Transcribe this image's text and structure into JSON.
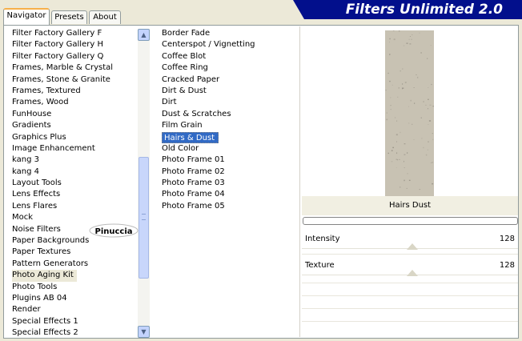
{
  "tabs": [
    "Navigator",
    "Presets",
    "About"
  ],
  "banner_title": "Filters Unlimited 2.0",
  "categories": [
    "Filter Factory Gallery F",
    "Filter Factory Gallery H",
    "Filter Factory Gallery Q",
    "Frames, Marble & Crystal",
    "Frames, Stone & Granite",
    "Frames, Textured",
    "Frames, Wood",
    "FunHouse",
    "Gradients",
    "Graphics Plus",
    "Image Enhancement",
    "kang 3",
    "kang 4",
    "Layout Tools",
    "Lens Effects",
    "Lens Flares",
    "Mock",
    "Noise Filters",
    "Paper Backgrounds",
    "Paper Textures",
    "Pattern Generators",
    "Photo Aging Kit",
    "Photo Tools",
    "Plugins AB 04",
    "Render",
    "Special Effects 1",
    "Special Effects 2"
  ],
  "selected_category": "Photo Aging Kit",
  "filters": [
    "Border Fade",
    "Centerspot / Vignetting",
    "Coffee Blot",
    "Coffee Ring",
    "Cracked Paper",
    "Dirt & Dust",
    "Dirt",
    "Dust & Scratches",
    "Film Grain",
    "Hairs & Dust",
    "Old Color",
    "Photo Frame 01",
    "Photo Frame 02",
    "Photo Frame 03",
    "Photo Frame 04",
    "Photo Frame 05"
  ],
  "selected_filter": "Hairs & Dust",
  "watermark_text": "Pinuccia",
  "preview_caption": "Hairs  Dust",
  "params": [
    {
      "label": "Intensity",
      "value": "128"
    },
    {
      "label": "Texture",
      "value": "128"
    }
  ],
  "colors": {
    "banner": "#020f8c",
    "selection": "#316ac5",
    "tab_highlight": "#f7b04a"
  },
  "icons": {
    "scroll_up": "chevron-up-icon",
    "scroll_down": "chevron-down-icon"
  }
}
